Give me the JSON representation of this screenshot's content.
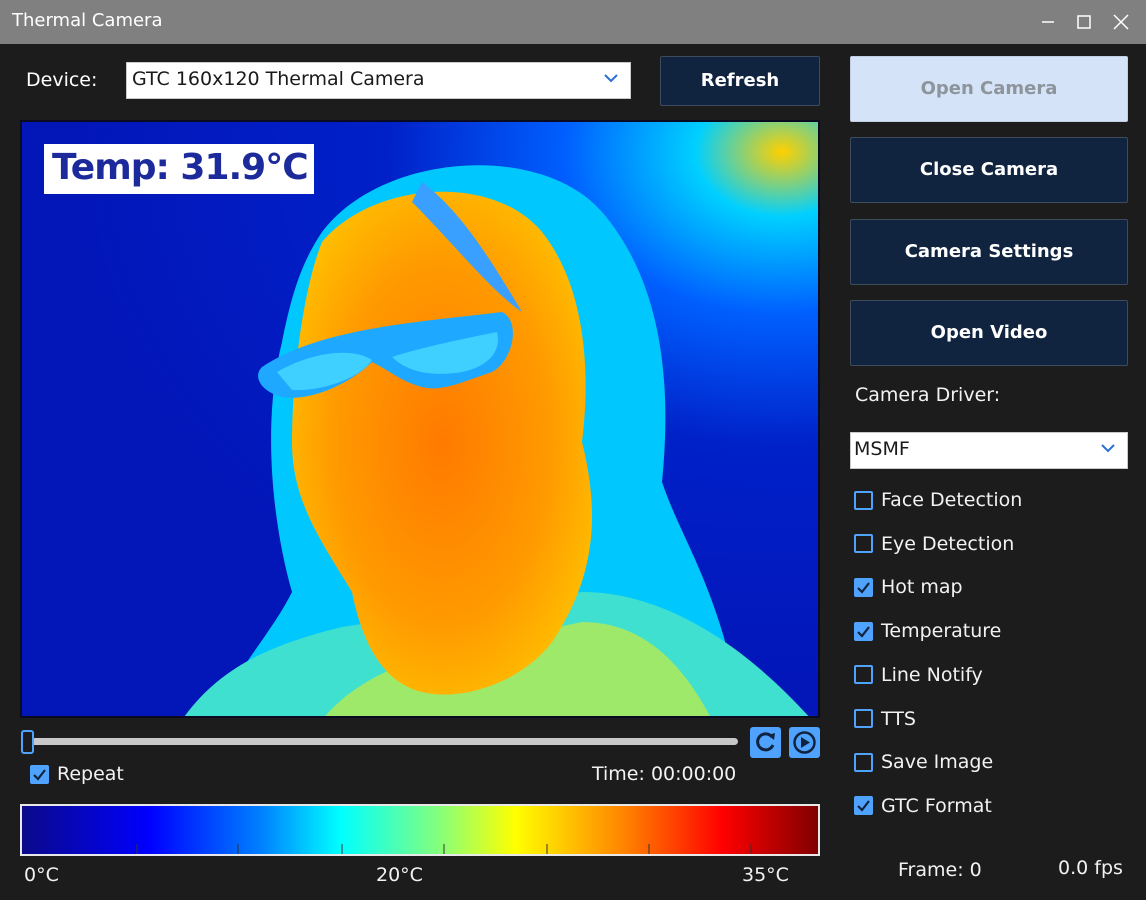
{
  "window": {
    "title": "Thermal Camera"
  },
  "device": {
    "label": "Device:",
    "selected": "GTC 160x120 Thermal Camera"
  },
  "buttons": {
    "refresh": "Refresh",
    "open_camera": "Open Camera",
    "close_camera": "Close Camera",
    "camera_settings": "Camera Settings",
    "open_video": "Open Video"
  },
  "viewer": {
    "temp_overlay": "Temp: 31.9°C"
  },
  "playback": {
    "repeat_label": "Repeat",
    "repeat_checked": true,
    "time_text": "Time: 00:00:00",
    "position": 0
  },
  "colorbar": {
    "labels": [
      "0°C",
      "20°C",
      "35°C"
    ]
  },
  "driver": {
    "label": "Camera Driver:",
    "selected": "MSMF"
  },
  "options": [
    {
      "label": "Face Detection",
      "checked": false
    },
    {
      "label": "Eye Detection",
      "checked": false
    },
    {
      "label": "Hot map",
      "checked": true
    },
    {
      "label": "Temperature",
      "checked": true
    },
    {
      "label": "Line Notify",
      "checked": false
    },
    {
      "label": "TTS",
      "checked": false
    },
    {
      "label": "Save Image",
      "checked": false
    },
    {
      "label": "GTC Format",
      "checked": true
    }
  ],
  "status": {
    "frame": "Frame: 0",
    "fps": "0.0 fps"
  },
  "colors": {
    "accent": "#4fa3ff",
    "button_bg": "#10233f",
    "window_bg": "#1c1c1c",
    "titlebar": "#808080"
  }
}
